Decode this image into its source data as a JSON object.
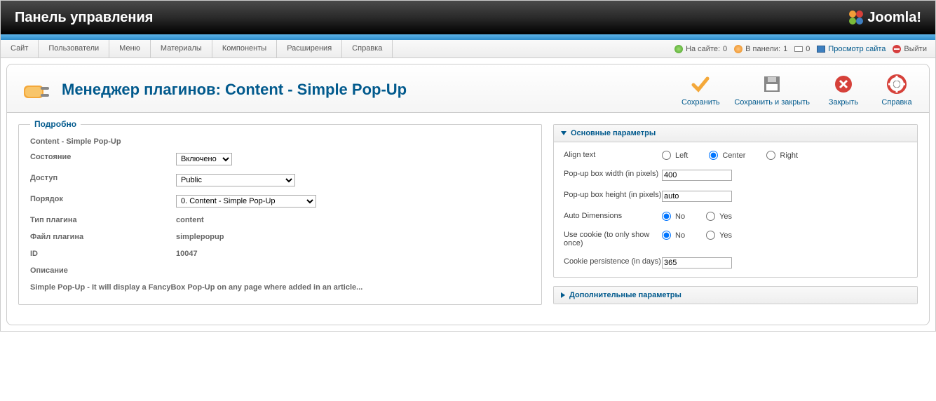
{
  "topbar": {
    "title": "Панель управления",
    "brand": "Joomla!"
  },
  "menu": {
    "items": [
      "Сайт",
      "Пользователи",
      "Меню",
      "Материалы",
      "Компоненты",
      "Расширения",
      "Справка"
    ]
  },
  "status": {
    "on_site_label": "На сайте:",
    "on_site_value": "0",
    "in_panel_label": "В панели:",
    "in_panel_value": "1",
    "messages_value": "0",
    "preview_label": "Просмотр сайта",
    "logout_label": "Выйти"
  },
  "header": {
    "title": "Менеджер плагинов: Content - Simple Pop-Up"
  },
  "toolbar": {
    "save": "Сохранить",
    "save_close": "Сохранить и закрыть",
    "cancel": "Закрыть",
    "help": "Справка"
  },
  "details": {
    "legend": "Подробно",
    "plugin_name": "Content - Simple Pop-Up",
    "state_label": "Состояние",
    "state_value": "Включено",
    "access_label": "Доступ",
    "access_value": "Public",
    "order_label": "Порядок",
    "order_value": "0. Content - Simple Pop-Up",
    "type_label": "Тип плагина",
    "type_value": "content",
    "file_label": "Файл плагина",
    "file_value": "simplepopup",
    "id_label": "ID",
    "id_value": "10047",
    "desc_label": "Описание",
    "desc_text": "Simple Pop-Up - It will display a FancyBox Pop-Up on any page where added in an article..."
  },
  "params": {
    "main_legend": "Основные параметры",
    "align_label": "Align text",
    "align_options": [
      "Left",
      "Center",
      "Right"
    ],
    "align_selected": "Center",
    "width_label": "Pop-up box width (in pixels)",
    "width_value": "400",
    "height_label": "Pop-up box height (in pixels)",
    "height_value": "auto",
    "autodim_label": "Auto Dimensions",
    "yesno": {
      "no": "No",
      "yes": "Yes"
    },
    "autodim_selected": "No",
    "cookie_label": "Use cookie (to only show once)",
    "cookie_selected": "No",
    "persist_label": "Cookie persistence (in days)",
    "persist_value": "365",
    "extra_legend": "Дополнительные параметры"
  }
}
